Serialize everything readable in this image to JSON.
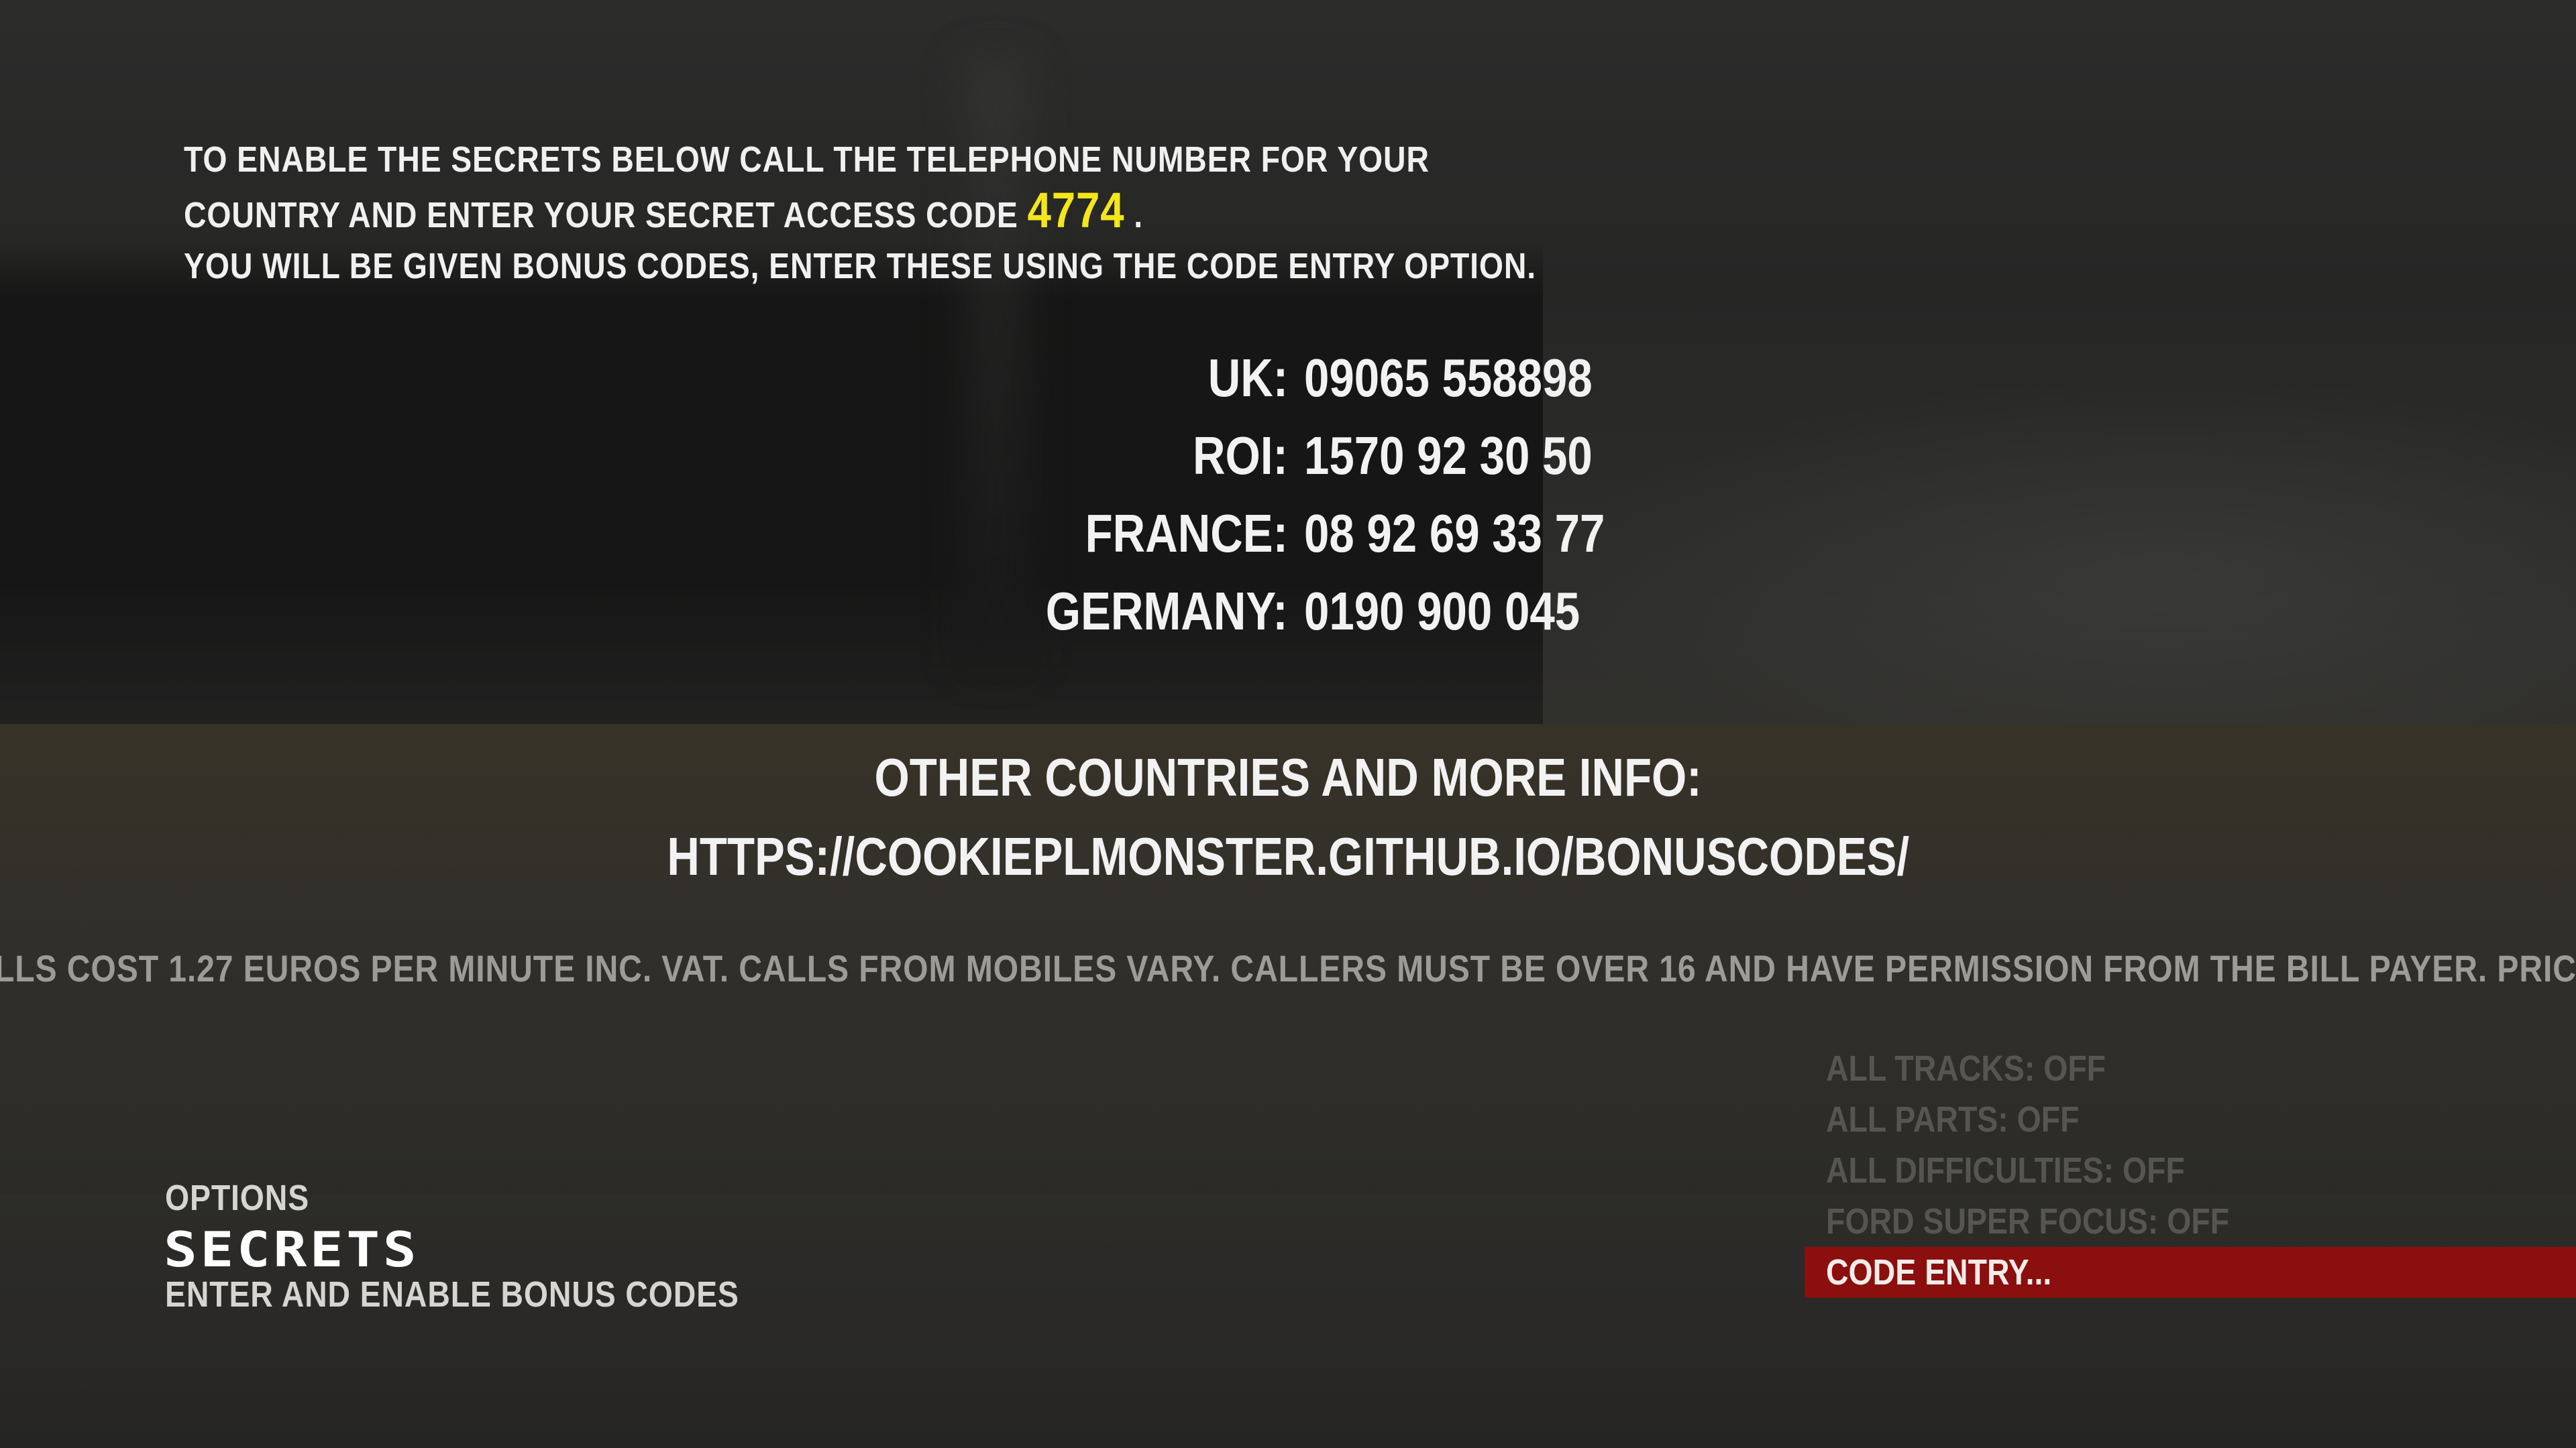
{
  "intro": {
    "line1": "TO ENABLE THE SECRETS BELOW CALL THE TELEPHONE NUMBER FOR YOUR",
    "line2_prefix": "COUNTRY AND ENTER YOUR SECRET ACCESS CODE",
    "access_code": "4774",
    "line2_suffix": ".",
    "line3": "YOU WILL BE GIVEN BONUS CODES, ENTER THESE USING THE CODE ENTRY OPTION."
  },
  "phones": [
    {
      "label": "UK:",
      "number": "09065 558898"
    },
    {
      "label": "ROI:",
      "number": "1570 92 30 50"
    },
    {
      "label": "FRANCE:",
      "number": "08 92 69 33 77"
    },
    {
      "label": "GERMANY:",
      "number": "0190 900 045"
    }
  ],
  "more_info": {
    "heading": "OTHER COUNTRIES AND MORE INFO:",
    "url": "HTTPS://COOKIEPLMONSTER.GITHUB.IO/BONUSCODES/"
  },
  "disclaimer": "LLS COST 1.27 EUROS PER MINUTE INC. VAT. CALLS FROM MOBILES VARY. CALLERS MUST BE OVER 16 AND HAVE PERMISSION FROM THE BILL PAYER. PRICES C",
  "menu": {
    "items": [
      {
        "label": "ALL TRACKS: OFF"
      },
      {
        "label": "ALL PARTS: OFF"
      },
      {
        "label": "ALL DIFFICULTIES: OFF"
      },
      {
        "label": "FORD SUPER FOCUS: OFF"
      },
      {
        "label": "CODE ENTRY..."
      }
    ],
    "selected_index": 4
  },
  "footer": {
    "breadcrumb": "OPTIONS",
    "title": "SECRETS",
    "description": "ENTER AND ENABLE BONUS CODES"
  },
  "colors": {
    "accent_code": "#f3e61a",
    "selected_bar": "#8a0f0e",
    "disabled_item": "#56554f"
  }
}
